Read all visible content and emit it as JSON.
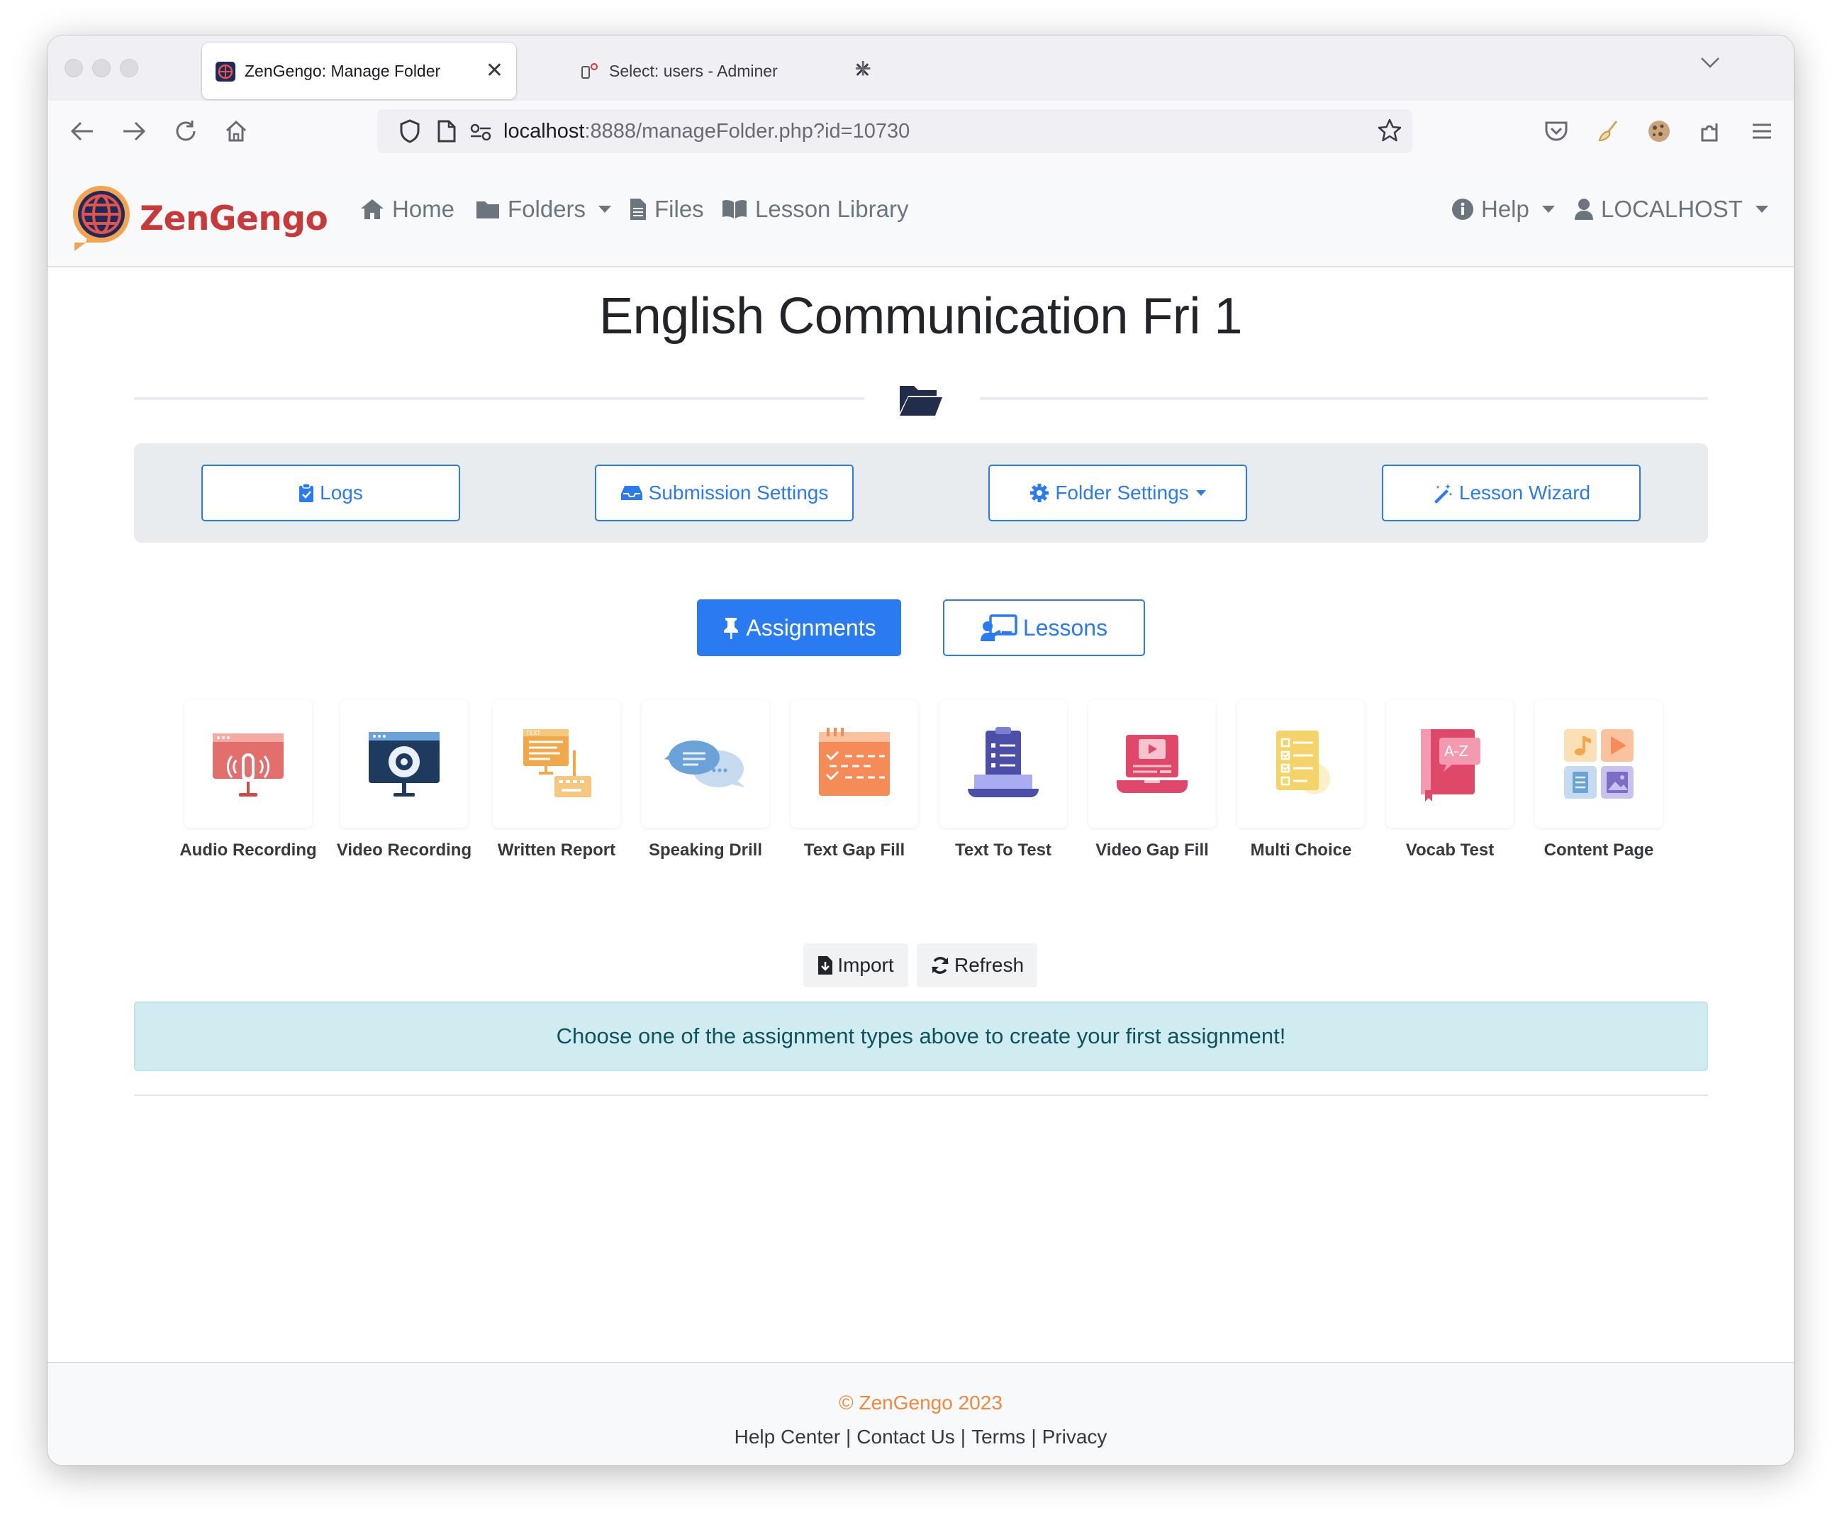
{
  "browser": {
    "tabs": [
      {
        "title": "ZenGengo: Manage Folder",
        "active": true
      },
      {
        "title": "Select: users - Adminer",
        "active": false
      }
    ],
    "url": {
      "host": "localhost",
      "rest": ":8888/manageFolder.php?id=10730"
    }
  },
  "nav": {
    "brand": "ZenGengo",
    "items": [
      {
        "label": "Home",
        "icon": "home-icon"
      },
      {
        "label": "Folders",
        "icon": "folder-icon",
        "dropdown": true
      },
      {
        "label": "Files",
        "icon": "file-icon"
      },
      {
        "label": "Lesson Library",
        "icon": "book-open-icon"
      }
    ],
    "help": "Help",
    "user": "LOCALHOST"
  },
  "page": {
    "title": "English Communication Fri 1",
    "actions": {
      "logs": "Logs",
      "submission_settings": "Submission Settings",
      "folder_settings": "Folder Settings",
      "lesson_wizard": "Lesson Wizard"
    },
    "toggles": {
      "assignments": "Assignments",
      "lessons": "Lessons"
    },
    "assignment_types": [
      {
        "label": "Audio Recording",
        "icon": "microphone-icon"
      },
      {
        "label": "Video Recording",
        "icon": "webcam-icon"
      },
      {
        "label": "Written Report",
        "icon": "text-report-icon"
      },
      {
        "label": "Speaking Drill",
        "icon": "speech-bubbles-icon"
      },
      {
        "label": "Text Gap Fill",
        "icon": "gap-fill-icon"
      },
      {
        "label": "Text To Test",
        "icon": "clipboard-laptop-icon"
      },
      {
        "label": "Video Gap Fill",
        "icon": "video-laptop-icon"
      },
      {
        "label": "Multi Choice",
        "icon": "checklist-icon"
      },
      {
        "label": "Vocab Test",
        "icon": "a-z-book-icon"
      },
      {
        "label": "Content Page",
        "icon": "media-grid-icon"
      }
    ],
    "import": "Import",
    "refresh": "Refresh",
    "alert": "Choose one of the assignment types above to create your first assignment!"
  },
  "footer": {
    "copyright": "© ZenGengo 2023",
    "links": [
      "Help Center",
      "Contact Us",
      "Terms",
      "Privacy"
    ],
    "separator": "|"
  },
  "colors": {
    "primary": "#2a7bf2",
    "brand_red": "#c8393a",
    "footer_orange": "#f0883e",
    "alert_bg": "#d1ecf1"
  }
}
